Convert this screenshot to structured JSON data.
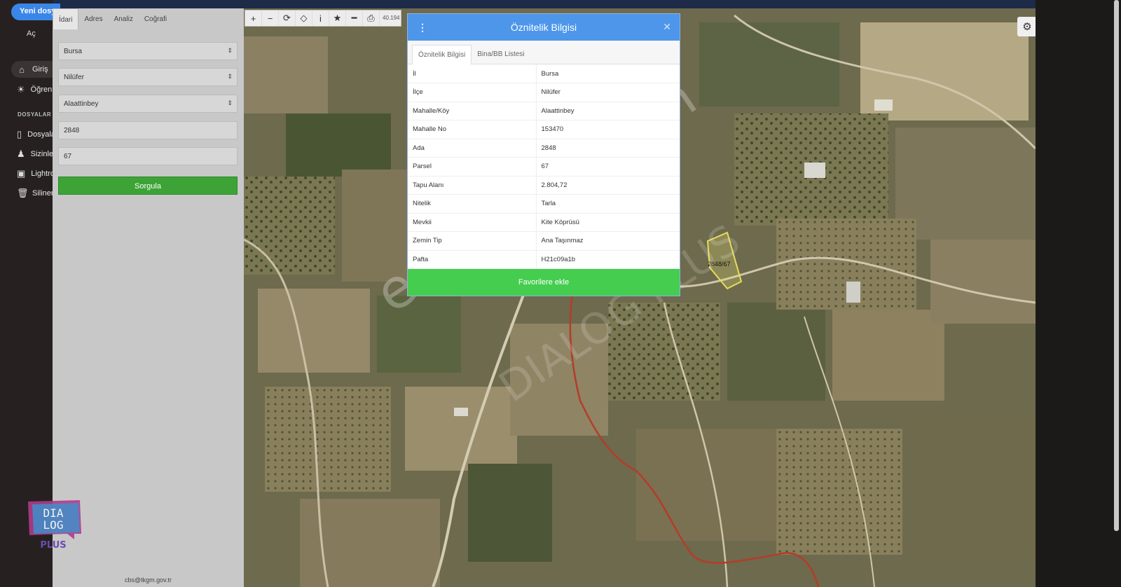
{
  "app": {
    "new_button": "Yeni dosya",
    "open_label": "Aç",
    "section_title": "DOSYALAR",
    "nav": [
      {
        "label": "Giriş",
        "icon": "home-icon"
      },
      {
        "label": "Öğrenin",
        "icon": "lightbulb-icon"
      },
      {
        "label": "Dosyalar",
        "icon": "file-icon"
      },
      {
        "label": "Sizinle paylaşılanlar",
        "icon": "person-icon"
      },
      {
        "label": "Lightroom",
        "icon": "lightroom-icon"
      },
      {
        "label": "Silinenler",
        "icon": "trash-icon"
      }
    ]
  },
  "query_panel": {
    "tabs": [
      "İdari",
      "Adres",
      "Analiz",
      "Coğrafi"
    ],
    "province": "Bursa",
    "district": "Nilüfer",
    "neighborhood": "Alaattinbey",
    "block": "2848",
    "parcel": "67",
    "query_button": "Sorgula",
    "footer": "cbs@tkgm.gov.tr"
  },
  "map": {
    "coord_readout": "40.194",
    "parcel_label": "2848/67"
  },
  "dialog": {
    "title": "Öznitelik Bilgisi",
    "tabs": [
      "Öznitelik Bilgisi",
      "Bina/BB Listesi"
    ],
    "rows": [
      {
        "key": "İl",
        "value": "Bursa"
      },
      {
        "key": "İlçe",
        "value": "Nilüfer"
      },
      {
        "key": "Mahalle/Köy",
        "value": "Alaattinbey"
      },
      {
        "key": "Mahalle No",
        "value": "153470"
      },
      {
        "key": "Ada",
        "value": "2848"
      },
      {
        "key": "Parsel",
        "value": "67"
      },
      {
        "key": "Tapu Alanı",
        "value": "2.804,72"
      },
      {
        "key": "Nitelik",
        "value": "Tarla"
      },
      {
        "key": "Mevkii",
        "value": "Kite Köprüsü"
      },
      {
        "key": "Zemin Tip",
        "value": "Ana Taşınmaz"
      },
      {
        "key": "Pafta",
        "value": "H21c09a1b"
      }
    ],
    "favorites_button": "Favorilere ekle"
  },
  "watermark": {
    "text": "emlakjet.com",
    "text2": "DIALOG PLUS"
  },
  "logo": {
    "line1": "DIA",
    "line2": "LOG",
    "line3": "PLUS"
  }
}
